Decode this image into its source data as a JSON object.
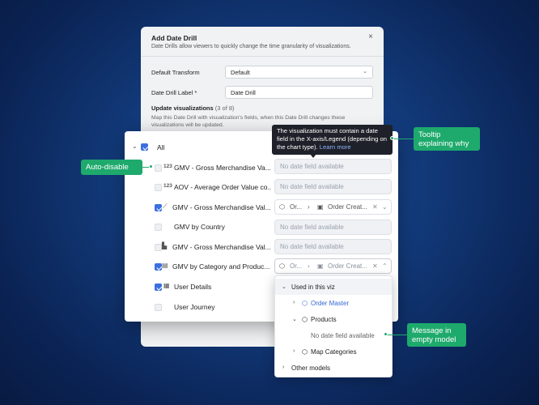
{
  "modal": {
    "title": "Add Date Drill",
    "close": "×",
    "subtitle": "Date Drills allow viewers to quickly change the time granularity of visualizations.",
    "default_transform_label": "Default Transform",
    "default_transform_value": "Default",
    "date_drill_label_label": "Date Drill Label *",
    "date_drill_label_value": "Date Drill",
    "update_title": "Update visualizations",
    "update_count": "(3 of 8)",
    "update_desc": "Map this Date Drill with visualization's fields, when this Date Drill changes these visualizations will be updated."
  },
  "list": {
    "all_label": "All",
    "rows": [
      {
        "icon": "123",
        "label": "GMV - Gross Merchandise Va...",
        "checked": false,
        "field": "No date field available"
      },
      {
        "icon": "123",
        "label": "AOV - Average Order Value co...",
        "checked": false,
        "field": "No date field available"
      },
      {
        "icon": "⟋",
        "label": "GMV - Gross Merchandise Val...",
        "checked": true,
        "field_a": "Or...",
        "field_b": "Order Creat..."
      },
      {
        "icon": "",
        "label": "GMV by Country",
        "checked": false,
        "field": "No date field available"
      },
      {
        "icon": "▙",
        "label": "GMV - Gross Merchandise Val...",
        "checked": false,
        "field": "No date field available"
      },
      {
        "icon": "▤",
        "label": "GMV by Category and Produc...",
        "checked": true,
        "field_a": "Or...",
        "field_b": "Order Creat..."
      },
      {
        "icon": "▦",
        "label": "User Details",
        "checked": true
      },
      {
        "icon": "",
        "label": "User Journey",
        "checked": false
      }
    ]
  },
  "tooltip": {
    "text": "The visualization must contain a date field in the X-axis/Legend (depending on the chart type).",
    "link": "Learn more"
  },
  "dropdown": {
    "used_in_viz": "Used in this viz",
    "order_master": "Order Master",
    "products": "Products",
    "no_date": "No date field available",
    "map_categories": "Map Categories",
    "other_models": "Other models"
  },
  "callouts": {
    "auto_disable": "Auto-disable",
    "tooltip_why": "Tooltip explaining why",
    "empty_model": "Message in empty model"
  },
  "colors": {
    "accent_green": "#1eaa6c",
    "checkbox_blue": "#3b6fe0",
    "link_blue": "#3466d6"
  }
}
